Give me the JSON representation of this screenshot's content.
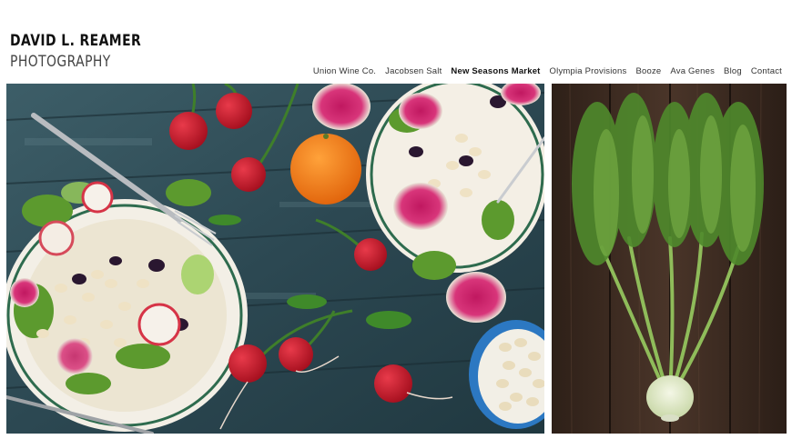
{
  "brand": {
    "line1": "DAVID L. REAMER",
    "line2": "PHOTOGRAPHY"
  },
  "nav": {
    "items": [
      {
        "label": "Union Wine Co.",
        "active": false
      },
      {
        "label": "Jacobsen Salt",
        "active": false
      },
      {
        "label": "New Seasons Market",
        "active": true
      },
      {
        "label": "Olympia Provisions",
        "active": false
      },
      {
        "label": "Booze",
        "active": false
      },
      {
        "label": "Ava Genes",
        "active": false
      },
      {
        "label": "Blog",
        "active": false
      },
      {
        "label": "Contact",
        "active": false
      }
    ]
  },
  "gallery": {
    "main_photo": "radish-and-white-bean-salad-photo",
    "side_photo": "fennel-bulbs-photo"
  },
  "colors": {
    "table_teal": "#2f4b55",
    "wood_brown": "#3a2a22",
    "plate_rim_green": "#2e6b4e",
    "radish_red": "#c8182a",
    "orange": "#ef7a12"
  }
}
